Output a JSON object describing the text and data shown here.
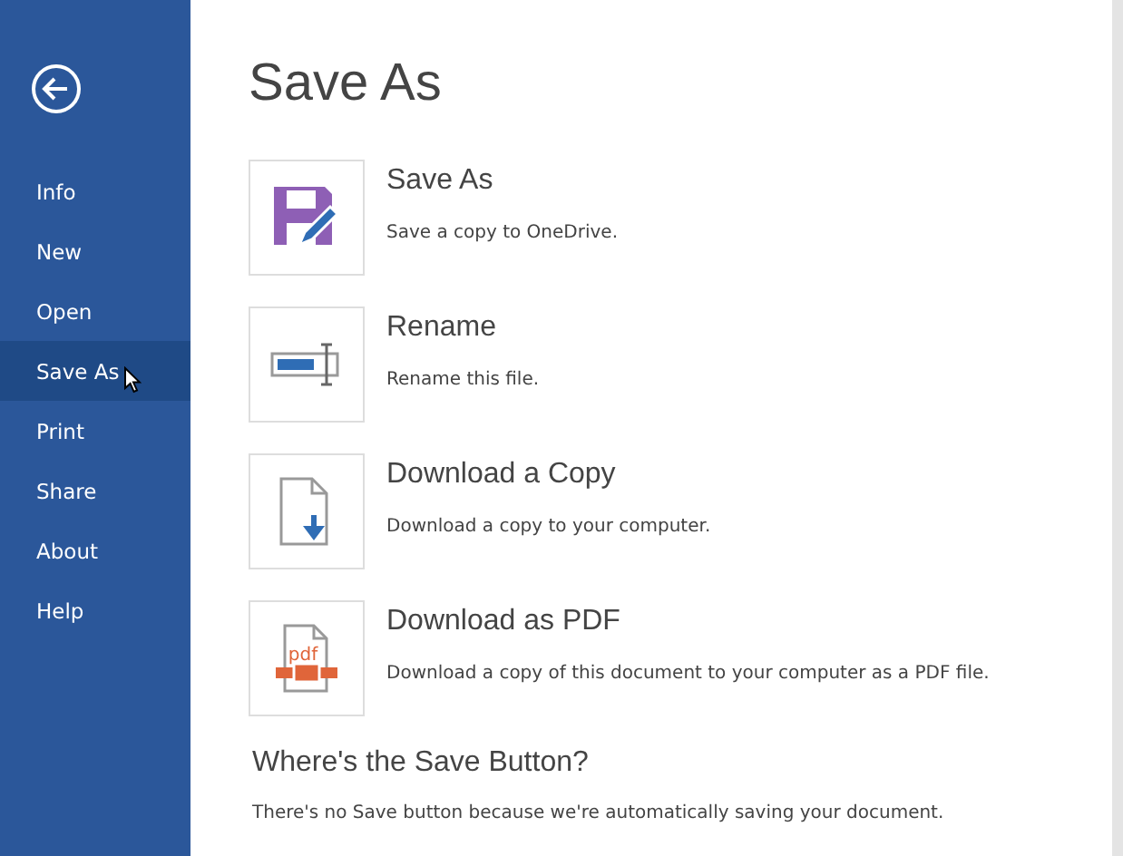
{
  "sidebar": {
    "items": [
      {
        "label": "Info",
        "selected": false
      },
      {
        "label": "New",
        "selected": false
      },
      {
        "label": "Open",
        "selected": false
      },
      {
        "label": "Save As",
        "selected": true
      },
      {
        "label": "Print",
        "selected": false
      },
      {
        "label": "Share",
        "selected": false
      },
      {
        "label": "About",
        "selected": false
      },
      {
        "label": "Help",
        "selected": false
      }
    ]
  },
  "page_title": "Save As",
  "options": [
    {
      "kind": "save",
      "title": "Save As",
      "description": "Save a copy to OneDrive."
    },
    {
      "kind": "rename",
      "title": "Rename",
      "description": "Rename this file."
    },
    {
      "kind": "download",
      "title": "Download a Copy",
      "description": "Download a copy to your computer."
    },
    {
      "kind": "pdf",
      "title": "Download as PDF",
      "description": "Download a copy of this document to your computer as a PDF file.",
      "icon_label": "pdf"
    }
  ],
  "info": {
    "heading": "Where's the Save Button?",
    "text": "There's no Save button because we're automatically saving your document."
  }
}
